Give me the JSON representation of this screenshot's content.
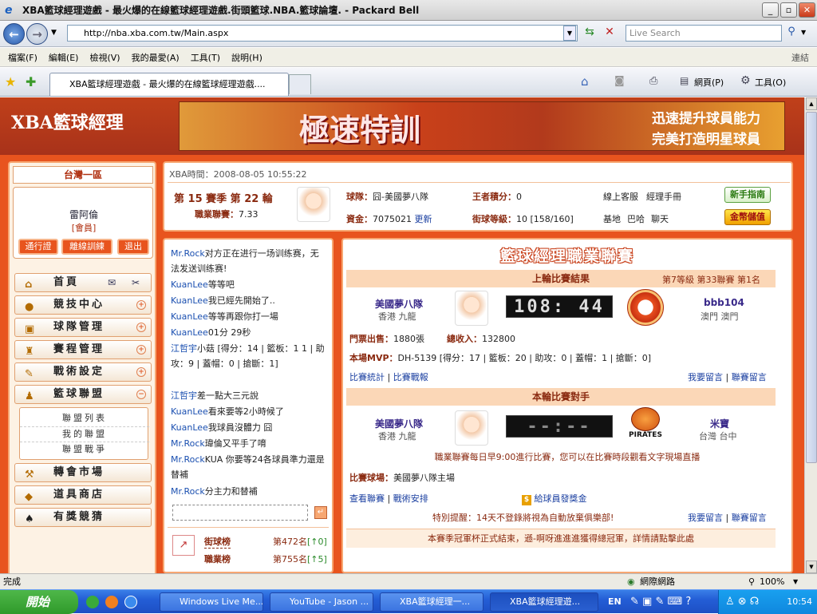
{
  "window": {
    "title": "XBA籃球經理遊戲 - 最火爆的在線籃球經理遊戲.街頭籃球.NBA.籃球論壇. - Packard Bell"
  },
  "browser": {
    "url": "http://nba.xba.com.tw/Main.aspx",
    "search_placeholder": "Live Search",
    "menu": [
      "檔案(F)",
      "編輯(E)",
      "檢視(V)",
      "我的最愛(A)",
      "工具(T)",
      "說明(H)"
    ],
    "links_label": "連結",
    "tab_title": "XBA籃球經理遊戲 - 最火爆的在線籃球經理遊戲....",
    "toolbar_page": "網頁(P)",
    "toolbar_tools": "工具(O)"
  },
  "site": {
    "logo": "XBA籃球經理",
    "banner_main": "極速特訓",
    "banner_line1": "迅速提升球員能力",
    "banner_line2": "完美打造明星球員"
  },
  "sidebar": {
    "region": "台灣一區",
    "username": "雷阿倫",
    "role": "[會員]",
    "buttons": [
      "通行證",
      "離線訓練",
      "退出"
    ],
    "nav": [
      {
        "label": "首頁",
        "icon": "home-icon"
      },
      {
        "label": "競技中心",
        "icon": "basketball-icon"
      },
      {
        "label": "球隊管理",
        "icon": "team-icon"
      },
      {
        "label": "賽程管理",
        "icon": "trophy-icon"
      },
      {
        "label": "戰術設定",
        "icon": "tactics-icon"
      },
      {
        "label": "籃球聯盟",
        "icon": "league-icon"
      },
      {
        "label": "轉會市場",
        "icon": "hammer-icon"
      },
      {
        "label": "道具商店",
        "icon": "shop-icon"
      },
      {
        "label": "有獎競猜",
        "icon": "spade-icon"
      }
    ],
    "subnav": [
      "聯盟列表",
      "我的聯盟",
      "聯盟戰爭"
    ]
  },
  "info": {
    "time_label": "XBA時間：",
    "time": "2008-08-05 10:55:22",
    "season": "第 15 賽季  第 22 輪",
    "league_label": "職業聯賽：",
    "league_value": "7.33",
    "team_label": "球隊：",
    "team_value": "囧-美國夢八隊",
    "points_label": "王者積分：",
    "points_value": "0",
    "service": "線上客服",
    "manual": "經理手冊",
    "funds_label": "資金：",
    "funds_value": "7075021",
    "refresh": "更新",
    "street_label": "街球等級：",
    "street_value": "10 [158/160]",
    "base": "基地",
    "bar": "巴哈",
    "talk": "聊天",
    "guide_btn": "新手指南",
    "gold_btn": "金幣儲值"
  },
  "chat": {
    "lines": [
      {
        "name": "Mr.Rock",
        "text": "对方正在进行一场训练赛，无法发送训练赛!"
      },
      {
        "name": "KuanLee",
        "text": "等等吧"
      },
      {
        "name": "KuanLee",
        "text": "我已經先開始了.."
      },
      {
        "name": "KuanLee",
        "text": "等等再跟你打一場"
      },
      {
        "name": "KuanLee",
        "text": "01分 29秒"
      },
      {
        "name": "江哲宇",
        "text": "小菇 [得分：14 | 籃板：1 1 | 助攻：9 | 蓋帽：0 | 搶斷：1]"
      },
      {
        "name": "江哲宇",
        "text": "差一點大三元說"
      },
      {
        "name": "KuanLee",
        "text": "看來要等2小時候了"
      },
      {
        "name": "KuanLee",
        "text": "我球員沒體力 囧"
      },
      {
        "name": "Mr.Rock",
        "text": "瑋倫又平手了唷"
      },
      {
        "name": "Mr.Rock",
        "text": "KUA 你要等24各球員準力還是替補"
      },
      {
        "name": "Mr.Rock",
        "text": "分主力和替補"
      }
    ],
    "rank1_label": "街球榜",
    "rank1_value": "第472名",
    "rank1_delta": "[↑0]",
    "rank2_label": "職業榜",
    "rank2_value": "第755名",
    "rank2_delta": "[↑5]"
  },
  "league": {
    "title": "籃球經理職業聯賽",
    "last_header": "上輪比賽結果",
    "last_meta": "第7等級  第33聯賽  第1名",
    "home_team": "美國夢八隊",
    "home_loc": "香港  九龍",
    "last_score": "108: 44",
    "away_team": "bbb104",
    "away_loc": "澳門  澳門",
    "ticket_label": "門票出售：",
    "ticket_value": "1880張",
    "income_label": "總收入：",
    "income_value": "132800",
    "mvp_label": "本場MVP：",
    "mvp_value": "DH-5139 [得分：17 | 籃板：20 | 助攻：0 | 蓋帽：1 | 搶斷：0]",
    "stats_link": "比賽統計",
    "report_link": "比賽戰報",
    "msg_link": "我要留言",
    "league_msg_link": "聯賽留言",
    "next_header": "本輪比賽對手",
    "next_home": "美國夢八隊",
    "next_home_loc": "香港  九龍",
    "next_score": "--:--",
    "next_away": "米寶",
    "next_away_loc": "台灣  台中",
    "pirates": "PIRATES",
    "notice": "職業聯賽每日早9:00進行比賽，您可以在比賽時段觀看文字現場直播",
    "venue_label": "比賽球場：",
    "venue_value": "美國夢八隊主場",
    "view_league": "查看聯賽",
    "tactics": "戰術安排",
    "bonus": "給球員發獎金",
    "reminder_label": "特別提醒：",
    "reminder_text": "14天不登錄將視為自動放棄俱樂部!",
    "footer": "本賽季冠軍杯正式結束，遜-啊呀進進進獲得總冠軍，詳情請點擊此處"
  },
  "status": {
    "text": "完成",
    "zone": "網際網路",
    "zoom": "100%"
  },
  "taskbar": {
    "start": "開始",
    "items": [
      "Windows Live Me...",
      "YouTube - Jason ...",
      "XBA籃球經理一...",
      "XBA籃球經理遊..."
    ],
    "lang": "EN",
    "clock": "10:54"
  }
}
